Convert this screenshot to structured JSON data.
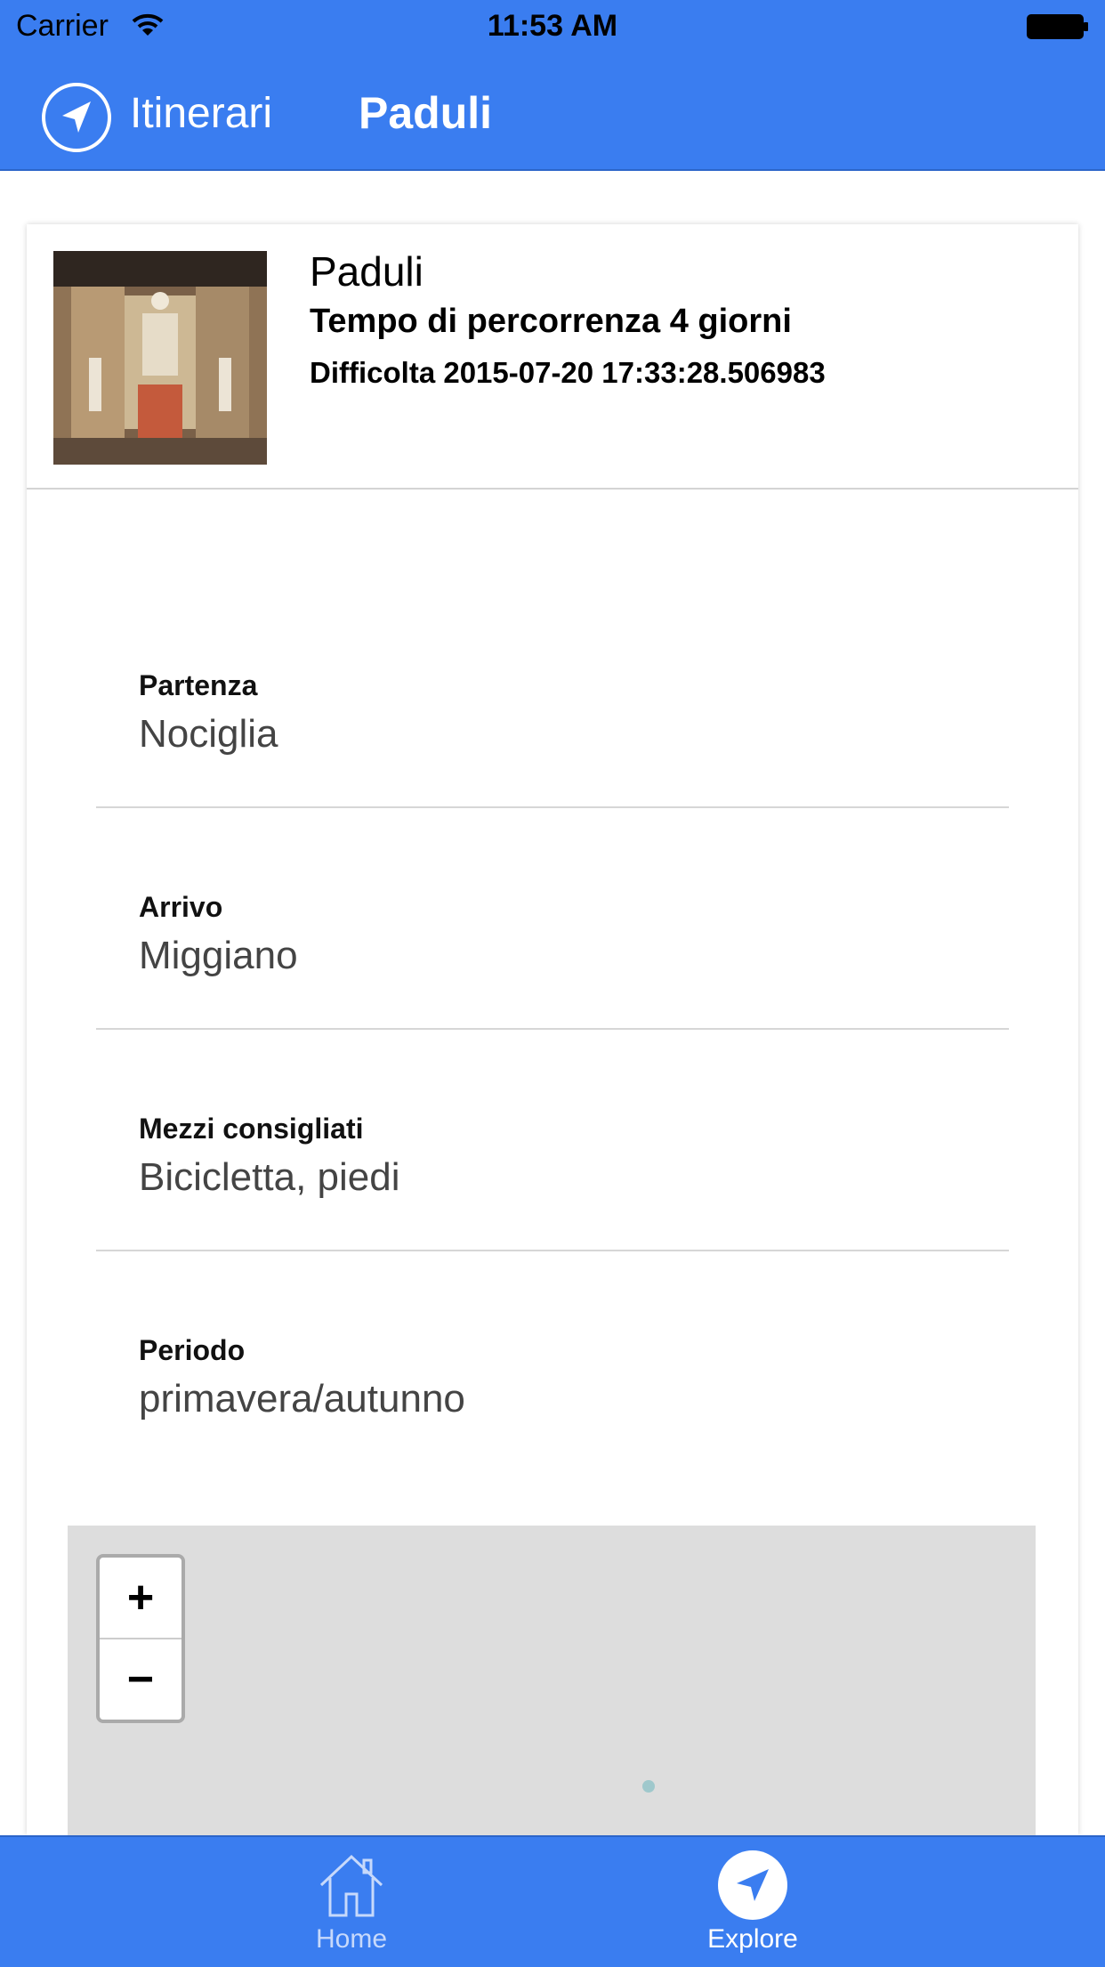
{
  "status_bar": {
    "carrier": "Carrier",
    "time": "11:53 AM"
  },
  "nav_bar": {
    "back_label": "Itinerari",
    "title": "Paduli"
  },
  "itinerary": {
    "title": "Paduli",
    "duration": "Tempo di percorrenza 4 giorni",
    "difficulty": "Difficolta 2015-07-20 17:33:28.506983"
  },
  "fields": [
    {
      "label": "Partenza",
      "value": "Nociglia"
    },
    {
      "label": "Arrivo",
      "value": "Miggiano"
    },
    {
      "label": "Mezzi consigliati",
      "value": "Bicicletta, piedi"
    },
    {
      "label": "Periodo",
      "value": "primavera/autunno"
    }
  ],
  "map": {
    "zoom_in": "+",
    "zoom_out": "−"
  },
  "tab_bar": {
    "tabs": [
      {
        "label": "Home",
        "icon": "home-icon",
        "selected": false
      },
      {
        "label": "Explore",
        "icon": "navigation-arrow-icon",
        "selected": true
      }
    ]
  },
  "colors": {
    "accent": "#3a7df0",
    "map_background": "#dddddd"
  }
}
